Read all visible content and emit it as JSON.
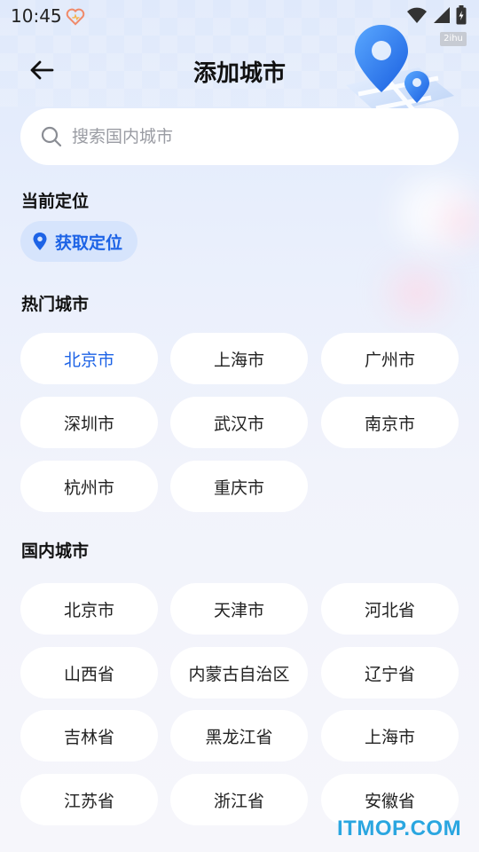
{
  "status_bar": {
    "time": "10:45",
    "icons": [
      "heart-icon",
      "wifi-icon",
      "signal-icon",
      "battery-icon"
    ]
  },
  "watermark_tag": "2ihu",
  "header": {
    "title": "添加城市",
    "back_icon": "arrow-left-icon"
  },
  "search": {
    "placeholder": "搜索国内城市",
    "value": ""
  },
  "current_location": {
    "section_title": "当前定位",
    "button_label": "获取定位"
  },
  "hot_cities": {
    "section_title": "热门城市",
    "items": [
      "北京市",
      "上海市",
      "广州市",
      "深圳市",
      "武汉市",
      "南京市",
      "杭州市",
      "重庆市"
    ],
    "selected": "北京市"
  },
  "domestic_cities": {
    "section_title": "国内城市",
    "items": [
      "北京市",
      "天津市",
      "河北省",
      "山西省",
      "内蒙古自治区",
      "辽宁省",
      "吉林省",
      "黑龙江省",
      "上海市",
      "江苏省",
      "浙江省",
      "安徽省"
    ]
  },
  "site_watermark": "ITMOP.COM",
  "colors": {
    "accent": "#1d63e6",
    "chip_bg": "#ffffff",
    "location_chip_bg": "#d6e4fc"
  }
}
